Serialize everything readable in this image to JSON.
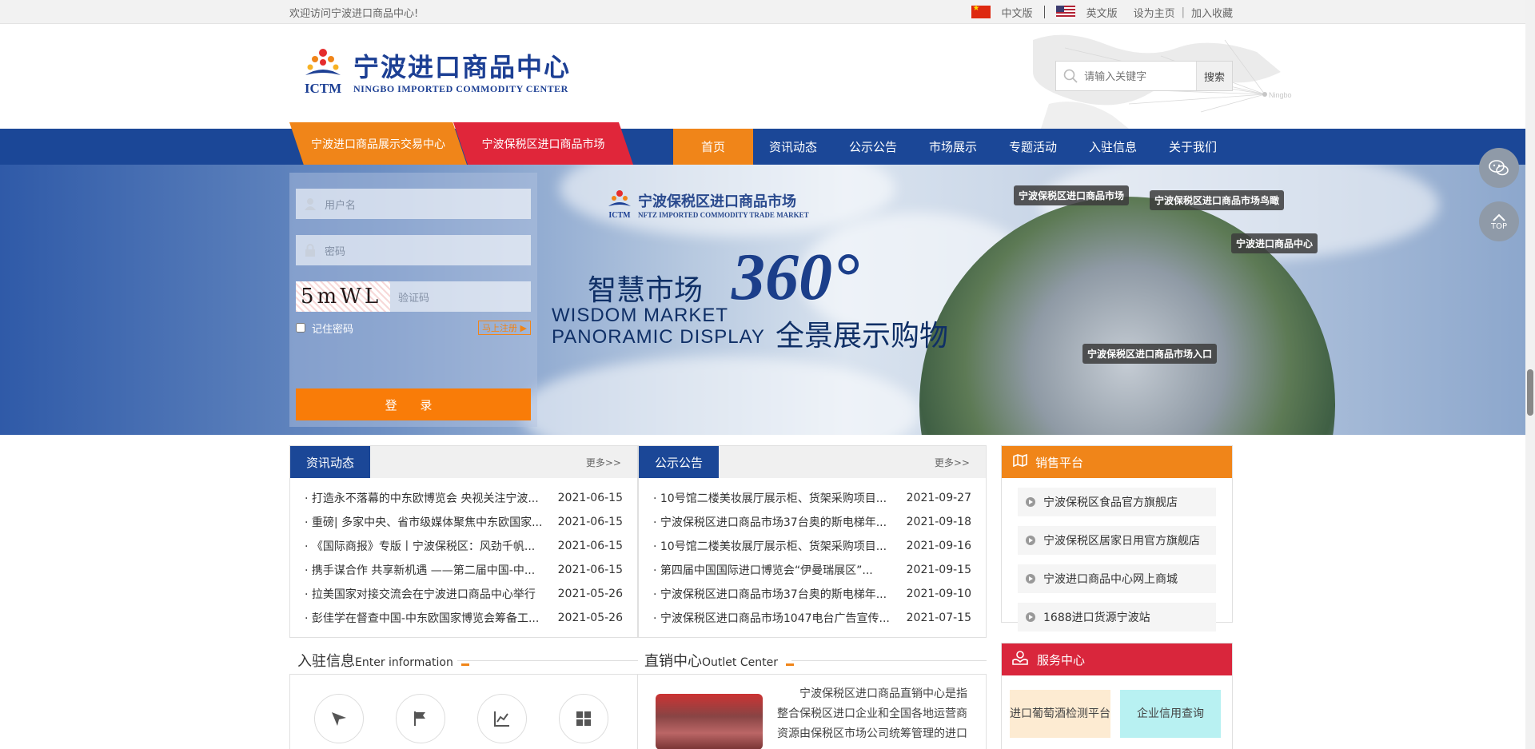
{
  "topbar": {
    "welcome": "欢迎访问宁波进口商品中心!",
    "lang_cn": "中文版",
    "lang_en": "英文版",
    "set_home": "设为主页",
    "add_fav": "加入收藏"
  },
  "header": {
    "logo_cn": "宁波进口商品中心",
    "logo_en": "NINGBO IMPORTED COMMODITY CENTER",
    "logo_abbr": "ICTM",
    "map_city": "Ningbo",
    "search_placeholder": "请输入关键字",
    "search_button": "搜索"
  },
  "nav": {
    "tag1": "宁波进口商品展示交易中心",
    "tag2": "宁波保税区进口商品市场",
    "items": [
      "首页",
      "资讯动态",
      "公示公告",
      "市场展示",
      "专题活动",
      "入驻信息",
      "关于我们"
    ]
  },
  "login": {
    "username_placeholder": "用户名",
    "password_placeholder": "密码",
    "captcha_text": "5mWL",
    "captcha_placeholder": "验证码",
    "remember": "记住密码",
    "register": "马上注册",
    "login_button": "登 录"
  },
  "banner": {
    "logo_cn": "宁波保税区进口商品市场",
    "logo_en": "NFTZ IMPORTED COMMODITY TRADE MARKET",
    "title": "智慧市场",
    "big": "360°",
    "en1": "WISDOM MARKET",
    "en2": "PANORAMIC DISPLAY",
    "subtitle": "全景展示购物",
    "labels": [
      "宁波保税区进口商品市场",
      "宁波保税区进口商品市场鸟瞰",
      "宁波进口商品中心",
      "宁波保税区进口商品市场入口"
    ]
  },
  "news": {
    "tab": "资讯动态",
    "more": "更多>>",
    "items": [
      {
        "title": "· 打造永不落幕的中东欧博览会 央视关注宁波...",
        "date": "2021-06-15"
      },
      {
        "title": "· 重磅| 多家中央、省市级媒体聚焦中东欧国家...",
        "date": "2021-06-15"
      },
      {
        "title": "· 《国际商报》专版丨宁波保税区：风劲千帆...",
        "date": "2021-06-15"
      },
      {
        "title": "· 携手谋合作 共享新机遇 ——第二届中国-中...",
        "date": "2021-06-15"
      },
      {
        "title": "· 拉美国家对接交流会在宁波进口商品中心举行",
        "date": "2021-05-26"
      },
      {
        "title": "· 彭佳学在督查中国-中东欧国家博览会筹备工...",
        "date": "2021-05-26"
      }
    ]
  },
  "notice": {
    "tab": "公示公告",
    "more": "更多>>",
    "items": [
      {
        "title": "· 10号馆二楼美妆展厅展示柜、货架采购项目...",
        "date": "2021-09-27"
      },
      {
        "title": "· 宁波保税区进口商品市场37台奥的斯电梯年...",
        "date": "2021-09-18"
      },
      {
        "title": "· 10号馆二楼美妆展厅展示柜、货架采购项目...",
        "date": "2021-09-16"
      },
      {
        "title": "· 第四届中国国际进口博览会“伊曼瑞展区”...",
        "date": "2021-09-15"
      },
      {
        "title": "· 宁波保税区进口商品市场37台奥的斯电梯年...",
        "date": "2021-09-10"
      },
      {
        "title": "· 宁波保税区进口商品市场1047电台广告宣传...",
        "date": "2021-07-15"
      }
    ]
  },
  "sale": {
    "title": "销售平台",
    "items": [
      "宁波保税区食品官方旗舰店",
      "宁波保税区居家日用官方旗舰店",
      "宁波进口商品中心网上商城",
      "1688进口货源宁波站"
    ]
  },
  "enter": {
    "title": "入驻信息",
    "en": "Enter information"
  },
  "outlet": {
    "title": "直销中心",
    "en": "Outlet Center",
    "text": "宁波保税区进口商品直销中心是指整合保税区进口企业和全国各地运营商资源由保税区市场公司统筹管理的进口"
  },
  "service": {
    "title": "服务中心",
    "btn1": "进口葡萄酒检测平台",
    "btn2": "企业信用查询"
  },
  "float": {
    "top": "TOP"
  },
  "colors": {
    "brand_blue": "#1b4797",
    "orange": "#f08519",
    "red": "#d9263c"
  }
}
